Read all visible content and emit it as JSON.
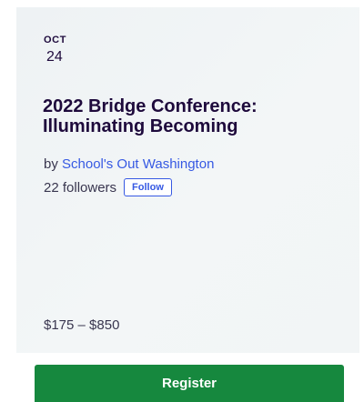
{
  "event": {
    "month": "OCT",
    "day": "24",
    "title": "2022 Bridge Conference: Illuminating Becoming",
    "organizer_prefix": "by",
    "organizer_name": "School's Out Washington",
    "followers": "22 followers",
    "follow_label": "Follow",
    "price": "$175 – $850"
  },
  "actions": {
    "register_label": "Register"
  },
  "colors": {
    "accent": "#3659e3",
    "register_green": "#16883e",
    "title_text": "#1e0a3c"
  }
}
